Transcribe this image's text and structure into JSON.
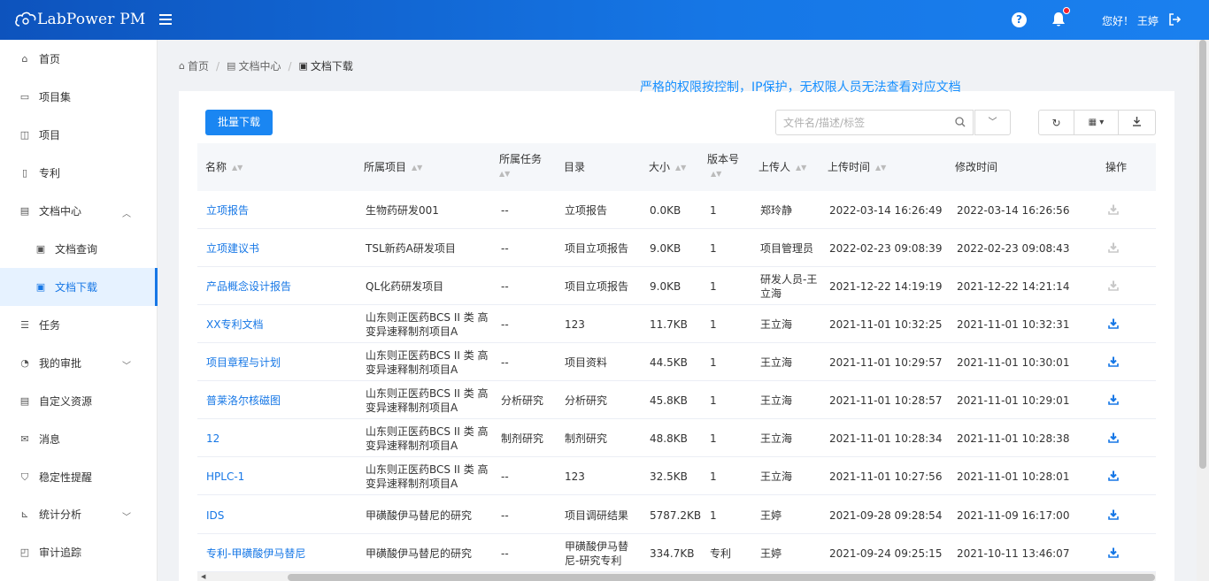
{
  "header": {
    "logo_text": "LabPower PM",
    "greeting": "您好！ 王婷"
  },
  "sidebar": {
    "items": [
      {
        "label": "首页",
        "icon": "home-icon"
      },
      {
        "label": "项目集",
        "icon": "folder-icon"
      },
      {
        "label": "项目",
        "icon": "project-icon"
      },
      {
        "label": "专利",
        "icon": "patent-icon"
      },
      {
        "label": "文档中心",
        "icon": "doc-center-icon",
        "expanded": true
      },
      {
        "label": "文档查询",
        "icon": "doc-icon"
      },
      {
        "label": "文档下载",
        "icon": "doc-icon",
        "active": true
      },
      {
        "label": "任务",
        "icon": "task-icon"
      },
      {
        "label": "我的审批",
        "icon": "approval-icon"
      },
      {
        "label": "自定义资源",
        "icon": "resource-icon"
      },
      {
        "label": "消息",
        "icon": "message-icon"
      },
      {
        "label": "稳定性提醒",
        "icon": "shield-icon"
      },
      {
        "label": "统计分析",
        "icon": "chart-icon"
      },
      {
        "label": "审计追踪",
        "icon": "audit-icon"
      }
    ]
  },
  "breadcrumb": {
    "home": "首页",
    "parent": "文档中心",
    "current": "文档下载"
  },
  "banner": "严格的权限按控制，IP保护，无权限人员无法查看对应文档",
  "toolbar": {
    "batch_download": "批量下载",
    "search_placeholder": "文件名/描述/标签"
  },
  "table": {
    "columns": [
      "名称",
      "所属项目",
      "所属任务",
      "目录",
      "大小",
      "版本号",
      "上传人",
      "上传时间",
      "修改时间",
      "操作"
    ],
    "rows": [
      {
        "name": "立项报告",
        "project": "生物药研发001",
        "task": "--",
        "dir": "立项报告",
        "size": "0.0KB",
        "version": "1",
        "uploader": "郑玲静",
        "uploaded": "2022-03-14 16:26:49",
        "modified": "2022-03-14 16:26:56",
        "downloadable": false
      },
      {
        "name": "立项建议书",
        "project": "TSL新药A研发项目",
        "task": "--",
        "dir": "项目立项报告",
        "size": "9.0KB",
        "version": "1",
        "uploader": "项目管理员",
        "uploaded": "2022-02-23 09:08:39",
        "modified": "2022-02-23 09:08:43",
        "downloadable": false
      },
      {
        "name": "产品概念设计报告",
        "project": "QL化药研发项目",
        "task": "--",
        "dir": "项目立项报告",
        "size": "9.0KB",
        "version": "1",
        "uploader": "研发人员-王立海",
        "uploaded": "2021-12-22 14:19:19",
        "modified": "2021-12-22 14:21:14",
        "downloadable": false
      },
      {
        "name": "XX专利文档",
        "project": "山东则正医药BCS II 类 高变异速释制剂项目A",
        "task": "--",
        "dir": "123",
        "size": "11.7KB",
        "version": "1",
        "uploader": "王立海",
        "uploaded": "2021-11-01 10:32:25",
        "modified": "2021-11-01 10:32:31",
        "downloadable": true
      },
      {
        "name": "项目章程与计划",
        "project": "山东则正医药BCS II 类 高变异速释制剂项目A",
        "task": "--",
        "dir": "项目资料",
        "size": "44.5KB",
        "version": "1",
        "uploader": "王立海",
        "uploaded": "2021-11-01 10:29:57",
        "modified": "2021-11-01 10:30:01",
        "downloadable": true
      },
      {
        "name": "普莱洛尔核磁图",
        "project": "山东则正医药BCS II 类 高变异速释制剂项目A",
        "task": "分析研究",
        "dir": "分析研究",
        "size": "45.8KB",
        "version": "1",
        "uploader": "王立海",
        "uploaded": "2021-11-01 10:28:57",
        "modified": "2021-11-01 10:29:01",
        "downloadable": true
      },
      {
        "name": "12",
        "project": "山东则正医药BCS II 类 高变异速释制剂项目A",
        "task": "制剂研究",
        "dir": "制剂研究",
        "size": "48.8KB",
        "version": "1",
        "uploader": "王立海",
        "uploaded": "2021-11-01 10:28:34",
        "modified": "2021-11-01 10:28:38",
        "downloadable": true
      },
      {
        "name": "HPLC-1",
        "project": "山东则正医药BCS II 类 高变异速释制剂项目A",
        "task": "--",
        "dir": "123",
        "size": "32.5KB",
        "version": "1",
        "uploader": "王立海",
        "uploaded": "2021-11-01 10:27:56",
        "modified": "2021-11-01 10:28:01",
        "downloadable": true
      },
      {
        "name": "IDS",
        "project": "甲磺酸伊马替尼的研究",
        "task": "--",
        "dir": "项目调研结果",
        "size": "5787.2KB",
        "version": "1",
        "uploader": "王婷",
        "uploaded": "2021-09-28 09:28:54",
        "modified": "2021-11-09 16:17:00",
        "downloadable": true
      },
      {
        "name": "专利-甲磺酸伊马替尼",
        "project": "甲磺酸伊马替尼的研究",
        "task": "--",
        "dir": "甲磺酸伊马替尼-研究专利",
        "size": "334.7KB",
        "version": "专利",
        "uploader": "王婷",
        "uploaded": "2021-09-24 09:25:15",
        "modified": "2021-10-11 13:46:07",
        "downloadable": true
      }
    ]
  },
  "colors": {
    "primary": "#1677e6",
    "header_start": "#0d53bd",
    "header_end": "#1a80ef",
    "banner": "#1890ff",
    "disabled_icon": "#c8c8c8"
  }
}
